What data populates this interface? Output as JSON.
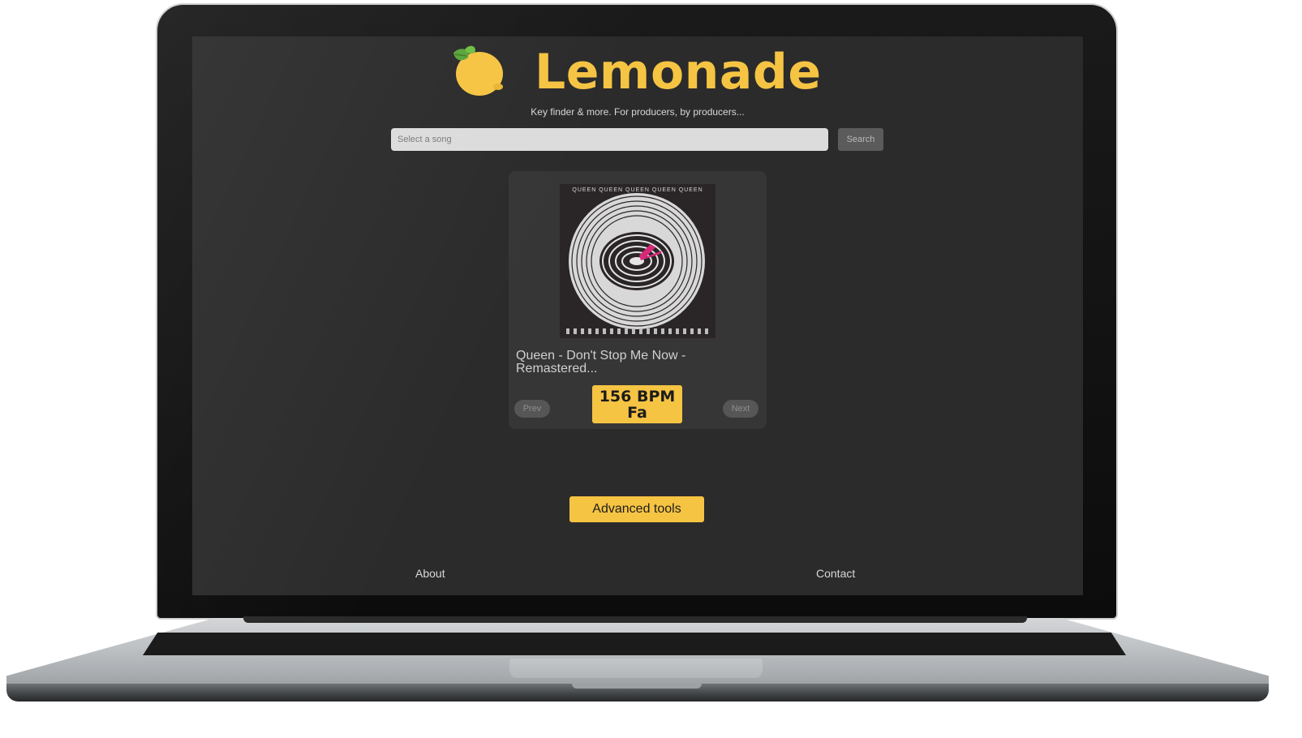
{
  "app": {
    "brand": "Lemonade",
    "tagline": "Key finder & more. For producers, by producers..."
  },
  "search": {
    "placeholder": "Select a song",
    "button_label": "Search"
  },
  "result_card": {
    "album_cover_text": "QUEEN QUEEN QUEEN QUEEN QUEEN",
    "song_title": "Queen - Don't Stop Me Now - Remastered...",
    "bpm": "156 BPM",
    "key": "Fa",
    "prev_label": "Prev",
    "next_label": "Next"
  },
  "advanced_button_label": "Advanced tools",
  "footer": {
    "about": "About",
    "contact": "Contact"
  },
  "colors": {
    "accent": "#f6c443",
    "background": "#2b2b2b",
    "card": "#363636"
  }
}
